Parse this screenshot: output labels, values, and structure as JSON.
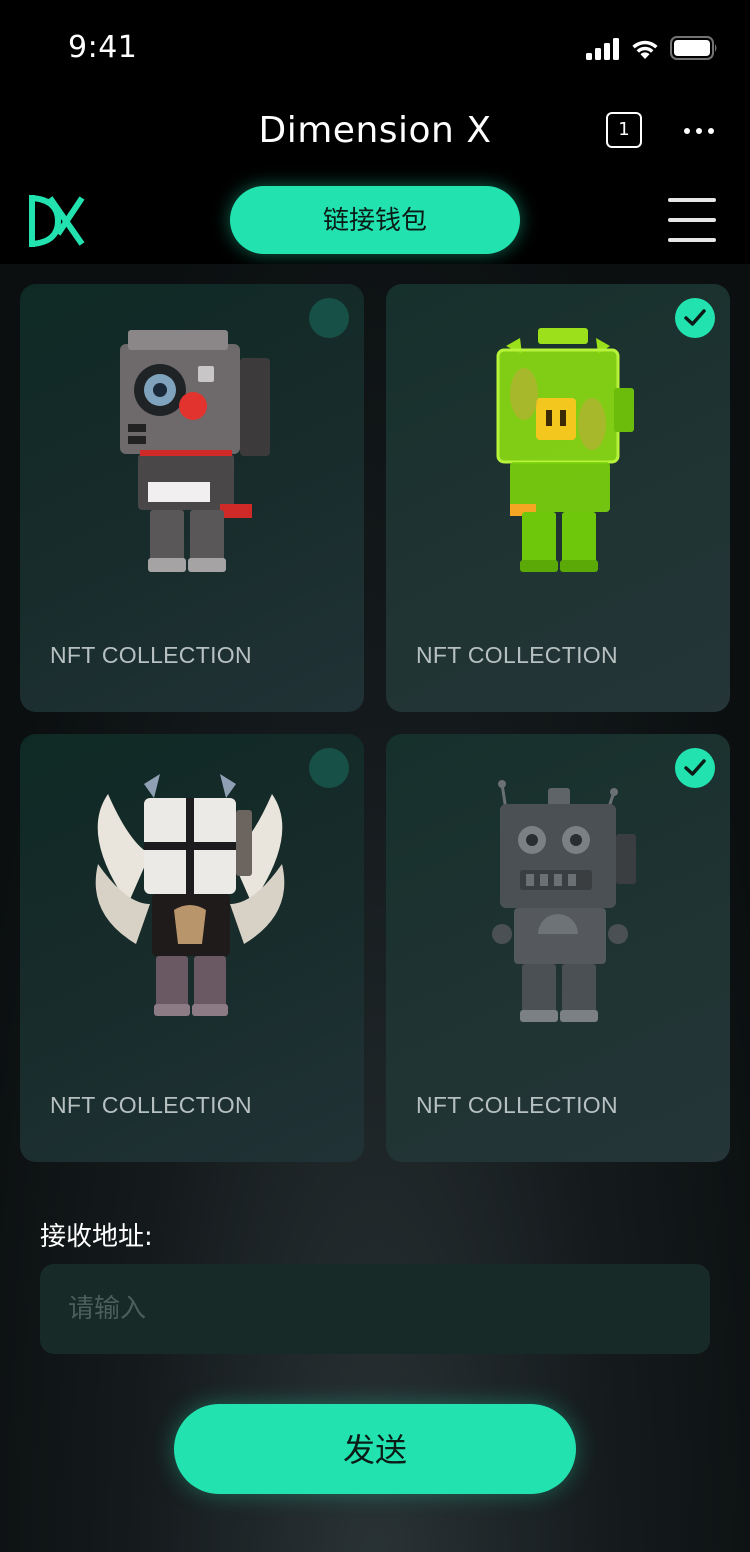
{
  "status_bar": {
    "time": "9:41"
  },
  "nav": {
    "title": "Dimension X",
    "tab_count": "1"
  },
  "header": {
    "connect_wallet_label": "链接钱包"
  },
  "collections": [
    {
      "label": "NFT COLLECTION",
      "selected": false,
      "figure": "camera-robot"
    },
    {
      "label": "NFT COLLECTION",
      "selected": true,
      "figure": "green-translucent-robot"
    },
    {
      "label": "NFT COLLECTION",
      "selected": false,
      "figure": "winged-knight-robot"
    },
    {
      "label": "NFT COLLECTION",
      "selected": true,
      "figure": "silver-retro-robot"
    }
  ],
  "form": {
    "address_label": "接收地址:",
    "address_placeholder": "请输入",
    "address_value": ""
  },
  "actions": {
    "send_label": "发送"
  },
  "colors": {
    "accent": "#22e3b0",
    "unselected_check": "#175046"
  }
}
